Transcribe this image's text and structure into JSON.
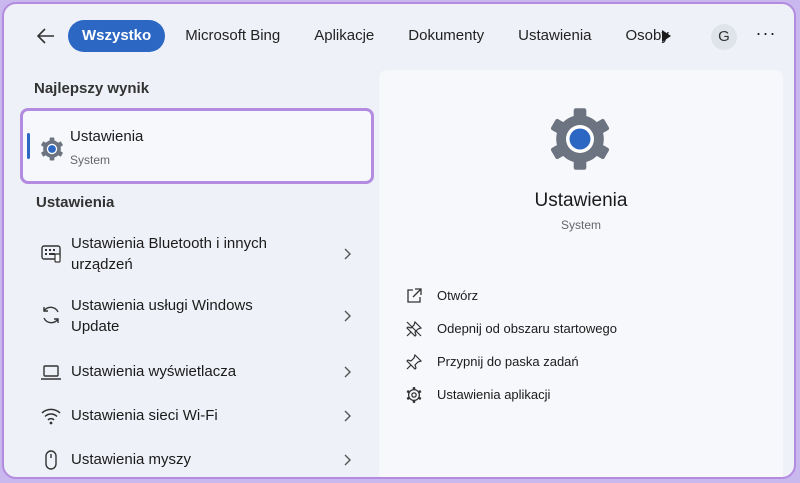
{
  "topbar": {
    "back_icon": "arrow-left-icon",
    "tabs": [
      {
        "label": "Wszystko",
        "active": true
      },
      {
        "label": "Microsoft Bing",
        "active": false
      },
      {
        "label": "Aplikacje",
        "active": false
      },
      {
        "label": "Dokumenty",
        "active": false
      },
      {
        "label": "Ustawienia",
        "active": false
      },
      {
        "label": "Osoby",
        "active": false
      }
    ],
    "more_tabs_icon": "play-icon",
    "avatar_initial": "G",
    "more_label": "···"
  },
  "left": {
    "best_heading": "Najlepszy wynik",
    "best": {
      "title": "Ustawienia",
      "subtitle": "System",
      "icon": "gear-icon"
    },
    "settings_heading": "Ustawienia",
    "items": [
      {
        "label": "Ustawienia Bluetooth i innych urządzeń",
        "icon": "bluetooth-devices-icon"
      },
      {
        "label": "Ustawienia usługi Windows Update",
        "icon": "refresh-icon"
      },
      {
        "label": "Ustawienia wyświetlacza",
        "icon": "laptop-icon"
      },
      {
        "label": "Ustawienia sieci Wi-Fi",
        "icon": "wifi-icon"
      },
      {
        "label": "Ustawienia myszy",
        "icon": "mouse-icon"
      }
    ]
  },
  "right": {
    "title": "Ustawienia",
    "subtitle": "System",
    "actions": [
      {
        "label": "Otwórz",
        "icon": "open-external-icon"
      },
      {
        "label": "Odepnij od obszaru startowego",
        "icon": "unpin-icon"
      },
      {
        "label": "Przypnij do paska zadań",
        "icon": "pin-icon"
      },
      {
        "label": "Ustawienia aplikacji",
        "icon": "settings-icon"
      }
    ]
  },
  "colors": {
    "accent": "#2c67c4",
    "highlight_border": "#b38be0",
    "background": "#eef1f7",
    "panel": "#f7f8fb"
  }
}
